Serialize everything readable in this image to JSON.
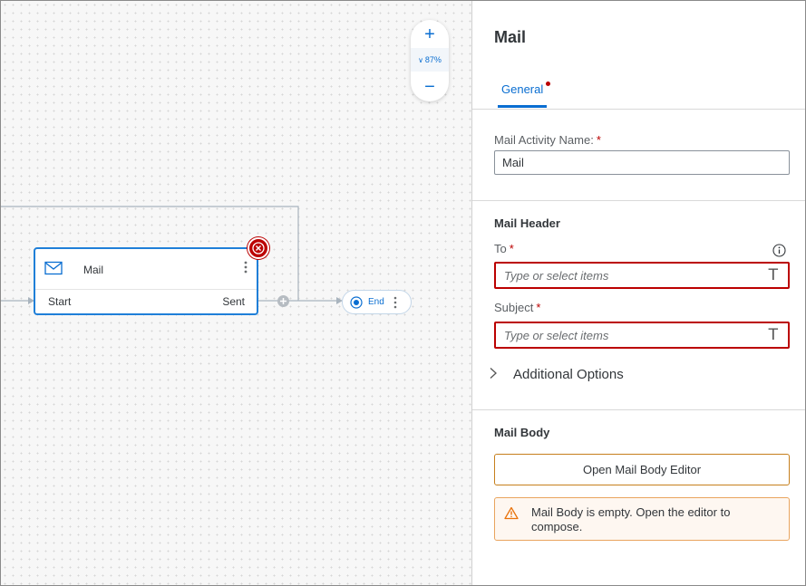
{
  "canvas": {
    "zoom": {
      "plus": "+",
      "minus": "−",
      "level": "87%"
    },
    "node": {
      "title": "Mail",
      "port_in": "Start",
      "port_out": "Sent"
    },
    "end_node": {
      "label": "End"
    }
  },
  "panel": {
    "title": "Mail",
    "tabs": [
      {
        "label": "General",
        "has_error": true
      }
    ],
    "activity_name": {
      "label": "Mail Activity Name:",
      "value": "Mail",
      "required": "*"
    },
    "mail_header": {
      "title": "Mail Header",
      "to": {
        "label": "To",
        "required": "*",
        "placeholder": "Type or select items"
      },
      "subject": {
        "label": "Subject",
        "required": "*",
        "placeholder": "Type or select items"
      },
      "additional_options": "Additional Options"
    },
    "mail_body": {
      "title": "Mail Body",
      "editor_button": "Open Mail Body Editor",
      "warning": "Mail Body is empty. Open the editor to compose."
    }
  },
  "colors": {
    "accent": "#0a6ed1",
    "error": "#bb0000",
    "warning": "#e9730c",
    "node_border": "#1f7fd8"
  },
  "icons": [
    "envelope-icon",
    "error-circle-icon",
    "more-vertical-icon",
    "add-circle-icon",
    "end-event-icon",
    "info-icon",
    "text-type-icon",
    "chevron-right-icon",
    "warning-icon"
  ]
}
